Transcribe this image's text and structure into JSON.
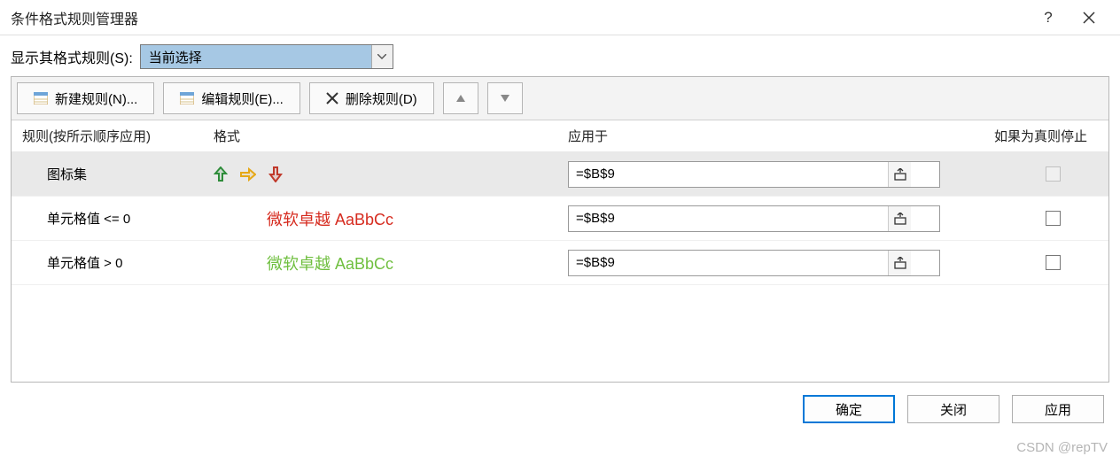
{
  "titlebar": {
    "title": "条件格式规则管理器",
    "help_label": "?",
    "close_label": "×"
  },
  "show_rules": {
    "label": "显示其格式规则(S):",
    "selected": "当前选择"
  },
  "toolbar": {
    "new_rule": "新建规则(N)...",
    "edit_rule": "编辑规则(E)...",
    "delete_rule": "删除规则(D)",
    "move_up": "▲",
    "move_down": "▼"
  },
  "headers": {
    "rule": "规则(按所示顺序应用)",
    "format": "格式",
    "applies_to": "应用于",
    "stop_if_true": "如果为真则停止"
  },
  "rules": [
    {
      "name": "图标集",
      "format_type": "iconset",
      "applies_to": "=$B$9",
      "stop_disabled": true
    },
    {
      "name": "单元格值 <= 0",
      "format_type": "text",
      "format_text": "微软卓越 AaBbCc",
      "format_color": "#d62b1f",
      "applies_to": "=$B$9",
      "stop_disabled": false
    },
    {
      "name": "单元格值 > 0",
      "format_type": "text",
      "format_text": "微软卓越 AaBbCc",
      "format_color": "#6fbf3f",
      "applies_to": "=$B$9",
      "stop_disabled": false
    }
  ],
  "iconset": {
    "up_color": "#2e8c3a",
    "right_color": "#e6a817",
    "down_color": "#c0392b"
  },
  "footer": {
    "ok": "确定",
    "close": "关闭",
    "apply": "应用"
  },
  "watermark": "CSDN @repTV"
}
